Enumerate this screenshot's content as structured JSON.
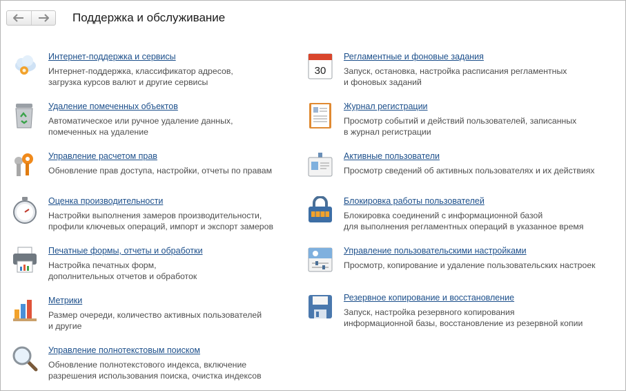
{
  "window": {
    "title": "Поддержка и обслуживание"
  },
  "nav": {
    "back_icon": "arrow-left-icon",
    "forward_icon": "arrow-right-icon"
  },
  "left_column": [
    {
      "icon": "cloud-gear-icon",
      "title": "Интернет-поддержка и сервисы",
      "desc": [
        "Интернет-поддержка, классификатор адресов,",
        "загрузка курсов валют и другие сервисы"
      ]
    },
    {
      "icon": "recycle-bin-icon",
      "title": "Удаление помеченных объектов",
      "desc": [
        "Автоматическое или ручное удаление данных,",
        "помеченных на удаление"
      ]
    },
    {
      "icon": "keys-icon",
      "title": "Управление расчетом прав",
      "desc": [
        "Обновление прав доступа, настройки, отчеты по правам"
      ]
    },
    {
      "icon": "stopwatch-icon",
      "title": "Оценка производительности",
      "desc": [
        "Настройки выполнения замеров производительности,",
        "профили ключевых операций, импорт и экспорт замеров"
      ]
    },
    {
      "icon": "printer-icon",
      "title": "Печатные формы, отчеты и обработки",
      "desc": [
        "Настройка печатных форм,",
        "дополнительных отчетов и обработок"
      ]
    },
    {
      "icon": "bar-chart-icon",
      "title": "Метрики",
      "desc": [
        "Размер очереди, количество активных пользователей",
        "и другие"
      ]
    },
    {
      "icon": "magnifier-icon",
      "title": "Управление полнотекстовым поиском",
      "desc": [
        "Обновление полнотекстового индекса, включение",
        "разрешения использования поиска, очистка индексов"
      ]
    }
  ],
  "right_column": [
    {
      "icon": "calendar-icon",
      "calendar_day": "30",
      "title": "Регламентные и фоновые задания",
      "desc": [
        "Запуск, остановка, настройка расписания регламентных",
        "и фоновых заданий"
      ]
    },
    {
      "icon": "journal-icon",
      "title": "Журнал регистрации",
      "desc": [
        "Просмотр событий и действий пользователей, записанных",
        "в журнал регистрации"
      ]
    },
    {
      "icon": "badge-icon",
      "title": "Активные пользователи",
      "desc": [
        "Просмотр сведений об активных пользователях и их действиях"
      ]
    },
    {
      "icon": "padlock-icon",
      "title": "Блокировка работы пользователей",
      "desc": [
        "Блокировка соединений с информационной базой",
        "для выполнения регламентных операций в указанное время"
      ]
    },
    {
      "icon": "user-settings-icon",
      "title": "Управление пользовательскими настройками",
      "desc": [
        "Просмотр, копирование и удаление пользовательских настроек"
      ]
    },
    {
      "icon": "floppy-disk-icon",
      "title": "Резервное копирование и восстановление",
      "desc": [
        "Запуск, настройка резервного копирования",
        "информационной базы, восстановление из резервной копии"
      ]
    }
  ]
}
